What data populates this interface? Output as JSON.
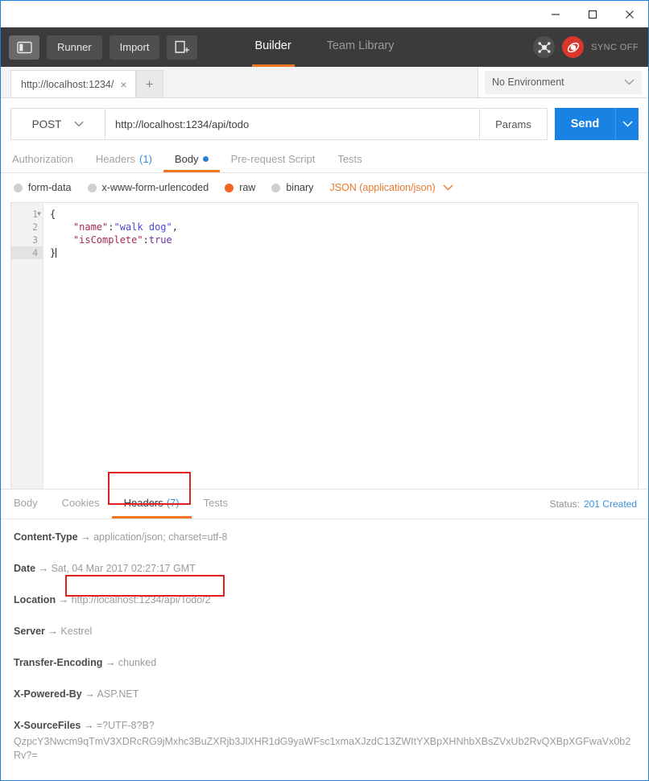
{
  "window": {
    "controls": {
      "minimize": "minimize-icon",
      "maximize": "maximize-icon",
      "close": "close-icon"
    }
  },
  "toolbar": {
    "sidebar_toggle": "sidebar-toggle-icon",
    "runner_label": "Runner",
    "import_label": "Import",
    "new_tab_label": "new-request-icon",
    "tabs": [
      {
        "label": "Builder",
        "selected": true
      },
      {
        "label": "Team Library",
        "selected": false
      }
    ],
    "settings_icon": "network-icon",
    "sync_icon": "sync-icon",
    "sync_label": "SYNC OFF",
    "accent": "#ef7622"
  },
  "tabstrip": {
    "request_tab_title": "http://localhost:1234/",
    "close_label": "×",
    "add_label": "+",
    "environment": {
      "value": "No Environment",
      "caret": "chevron-down-icon"
    }
  },
  "request": {
    "method": "POST",
    "method_caret": "chevron-down-icon",
    "url": "http://localhost:1234/api/todo",
    "params_label": "Params",
    "send_label": "Send",
    "send_caret": "chevron-down-icon",
    "tabs": [
      {
        "label": "Authorization",
        "count": "",
        "selected": false
      },
      {
        "label": "Headers",
        "count": "(1)",
        "selected": false
      },
      {
        "label": "Body",
        "count": "",
        "selected": true,
        "dot": true
      },
      {
        "label": "Pre-request Script",
        "count": "",
        "selected": false
      },
      {
        "label": "Tests",
        "count": "",
        "selected": false
      }
    ],
    "body_types": [
      {
        "label": "form-data",
        "selected": false
      },
      {
        "label": "x-www-form-urlencoded",
        "selected": false
      },
      {
        "label": "raw",
        "selected": true
      },
      {
        "label": "binary",
        "selected": false
      }
    ],
    "content_type": "JSON (application/json)",
    "content_type_caret": "chevron-down-icon",
    "editor": {
      "line_numbers": [
        "1",
        "2",
        "3",
        "4"
      ],
      "lines": [
        {
          "n": "1",
          "fold": true,
          "tokens": [
            {
              "t": "{",
              "c": "k-pun"
            }
          ]
        },
        {
          "n": "2",
          "fold": false,
          "tokens": [
            {
              "t": "    ",
              "c": "k-pun"
            },
            {
              "t": "\"name\"",
              "c": "k-key"
            },
            {
              "t": ":",
              "c": "k-pun"
            },
            {
              "t": "\"walk dog\"",
              "c": "k-str"
            },
            {
              "t": ",",
              "c": "k-pun"
            }
          ]
        },
        {
          "n": "3",
          "fold": false,
          "tokens": [
            {
              "t": "    ",
              "c": "k-pun"
            },
            {
              "t": "\"isComplete\"",
              "c": "k-key"
            },
            {
              "t": ":",
              "c": "k-pun"
            },
            {
              "t": "true",
              "c": "k-lit"
            }
          ]
        },
        {
          "n": "4",
          "fold": false,
          "current": true,
          "tokens": [
            {
              "t": "}",
              "c": "k-pun"
            }
          ]
        }
      ]
    }
  },
  "response": {
    "tabs": [
      {
        "label": "Body",
        "count": "",
        "selected": false
      },
      {
        "label": "Cookies",
        "count": "",
        "selected": false
      },
      {
        "label": "Headers",
        "count": "(7)",
        "selected": true
      },
      {
        "label": "Tests",
        "count": "",
        "selected": false
      }
    ],
    "status_label": "Status:",
    "status_value": "201 Created",
    "headers": [
      {
        "name": "Content-Type",
        "arrow": "→",
        "value": "application/json; charset=utf-8",
        "highlight": false
      },
      {
        "name": "Date",
        "arrow": "→",
        "value": "Sat, 04 Mar 2017 02:27:17 GMT",
        "highlight": false
      },
      {
        "name": "Location",
        "arrow": "→",
        "value": "http://localhost:1234/api/Todo/2",
        "highlight": true
      },
      {
        "name": "Server",
        "arrow": "→",
        "value": "Kestrel",
        "highlight": false
      },
      {
        "name": "Transfer-Encoding",
        "arrow": "→",
        "value": "chunked",
        "highlight": false
      },
      {
        "name": "X-Powered-By",
        "arrow": "→",
        "value": "ASP.NET",
        "highlight": false
      },
      {
        "name": "X-SourceFiles",
        "arrow": "→",
        "value": "=?UTF-8?B?",
        "value2": "QzpcY3Nwcm9qTmV3XDRcRG9jMxhc3BuZXRjb3JlXHR1dG9yaWFsc1xmaXJzdC13ZWItYXBpXHNhbXBsZVxUb2RvQXBpXGFwaVx0b2Rv?=",
        "highlight": false
      }
    ]
  },
  "annotations": {
    "headers_tab_box": "red-highlight-box",
    "location_value_box": "red-highlight-box",
    "color": "#e02020"
  }
}
